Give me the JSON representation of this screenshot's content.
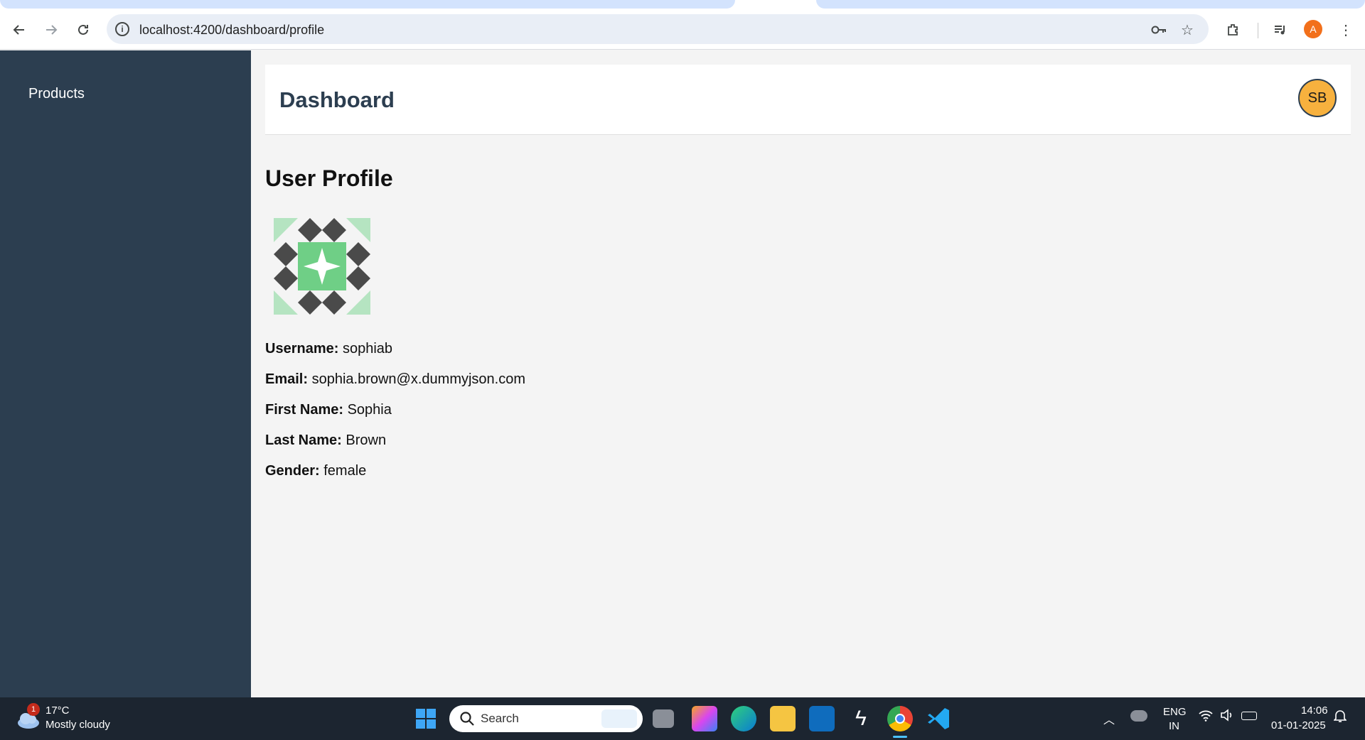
{
  "browser": {
    "url": "localhost:4200/dashboard/profile",
    "profile_initial": "A"
  },
  "sidebar": {
    "items": [
      {
        "label": "Products"
      }
    ]
  },
  "header": {
    "title": "Dashboard",
    "avatar_initials": "SB"
  },
  "profile": {
    "title": "User Profile",
    "fields": [
      {
        "label": "Username:",
        "value": "sophiab"
      },
      {
        "label": "Email:",
        "value": "sophia.brown@x.dummyjson.com"
      },
      {
        "label": "First Name:",
        "value": "Sophia"
      },
      {
        "label": "Last Name:",
        "value": "Brown"
      },
      {
        "label": "Gender:",
        "value": "female"
      }
    ]
  },
  "taskbar": {
    "weather_temp": "17°C",
    "weather_desc": "Mostly cloudy",
    "weather_badge": "1",
    "search_placeholder": "Search",
    "lang_1": "ENG",
    "lang_2": "IN",
    "time": "14:06",
    "date": "01-01-2025"
  },
  "colors": {
    "sidebar": "#2c3e50",
    "avatar": "#f7b13e",
    "identicon_green": "#6fcf86",
    "identicon_dark": "#4a4a4a"
  }
}
